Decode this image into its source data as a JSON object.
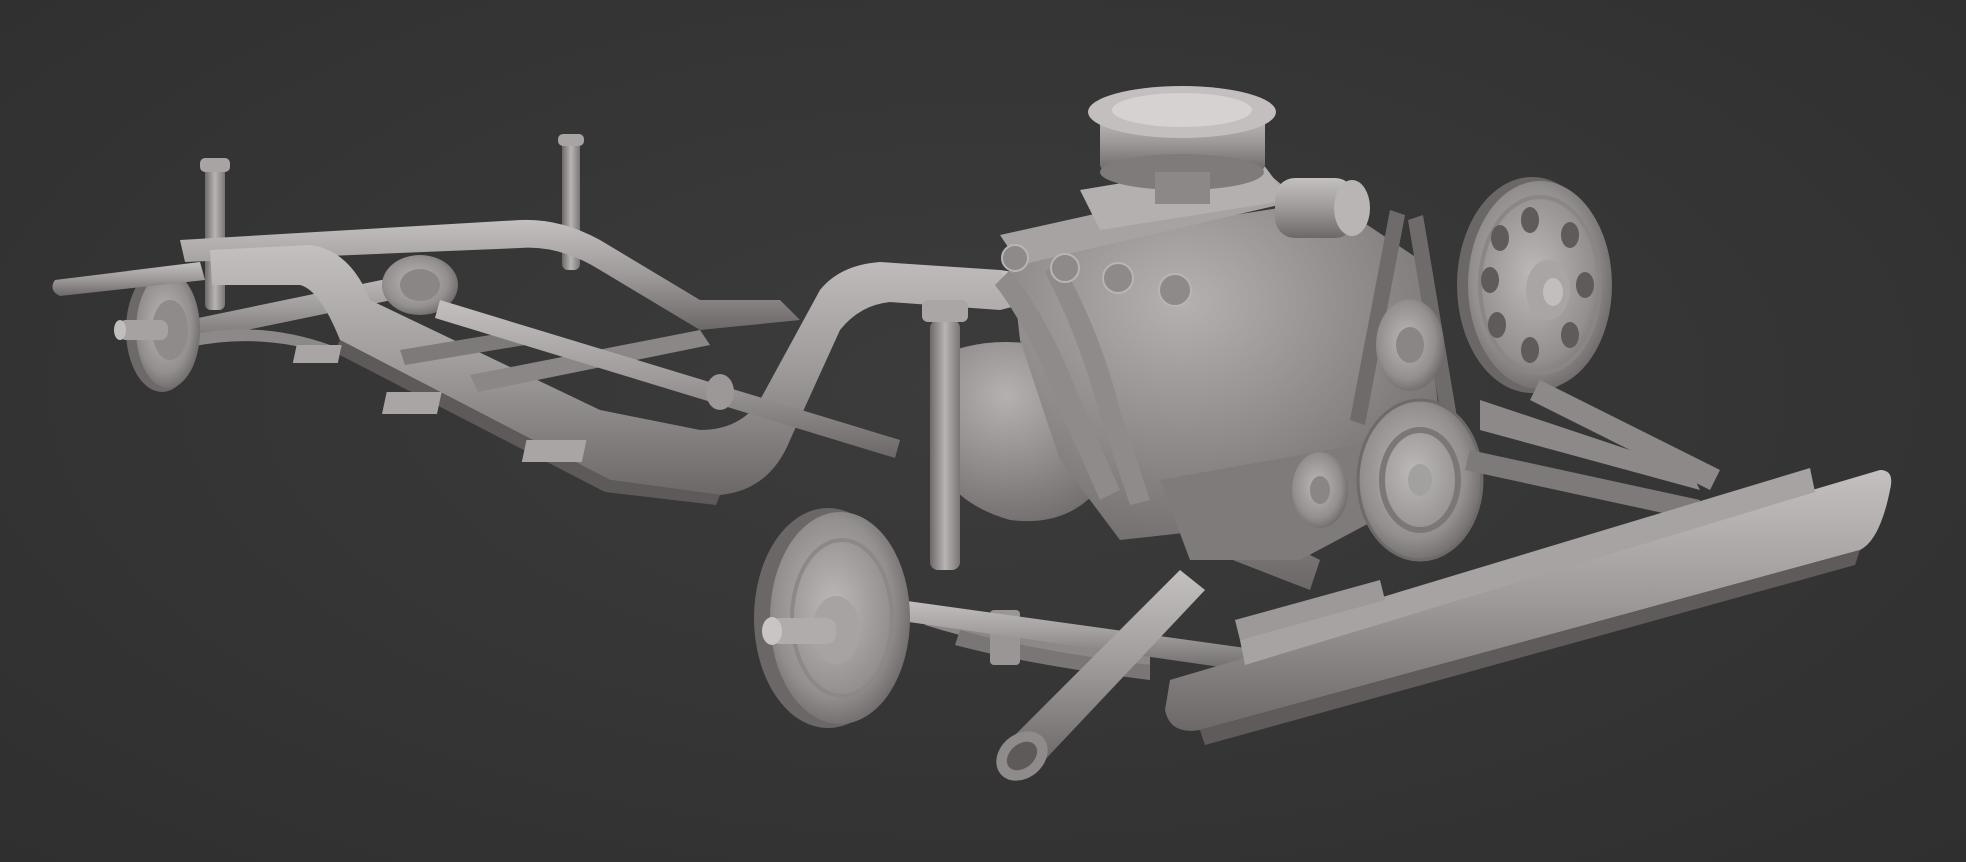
{
  "scene": {
    "background_color": "#363636",
    "model_color": "#9e9a9a",
    "highlight_color": "#c9c5c5",
    "shadow_color": "#5e5a5a",
    "subject": "chassis-with-engine"
  }
}
